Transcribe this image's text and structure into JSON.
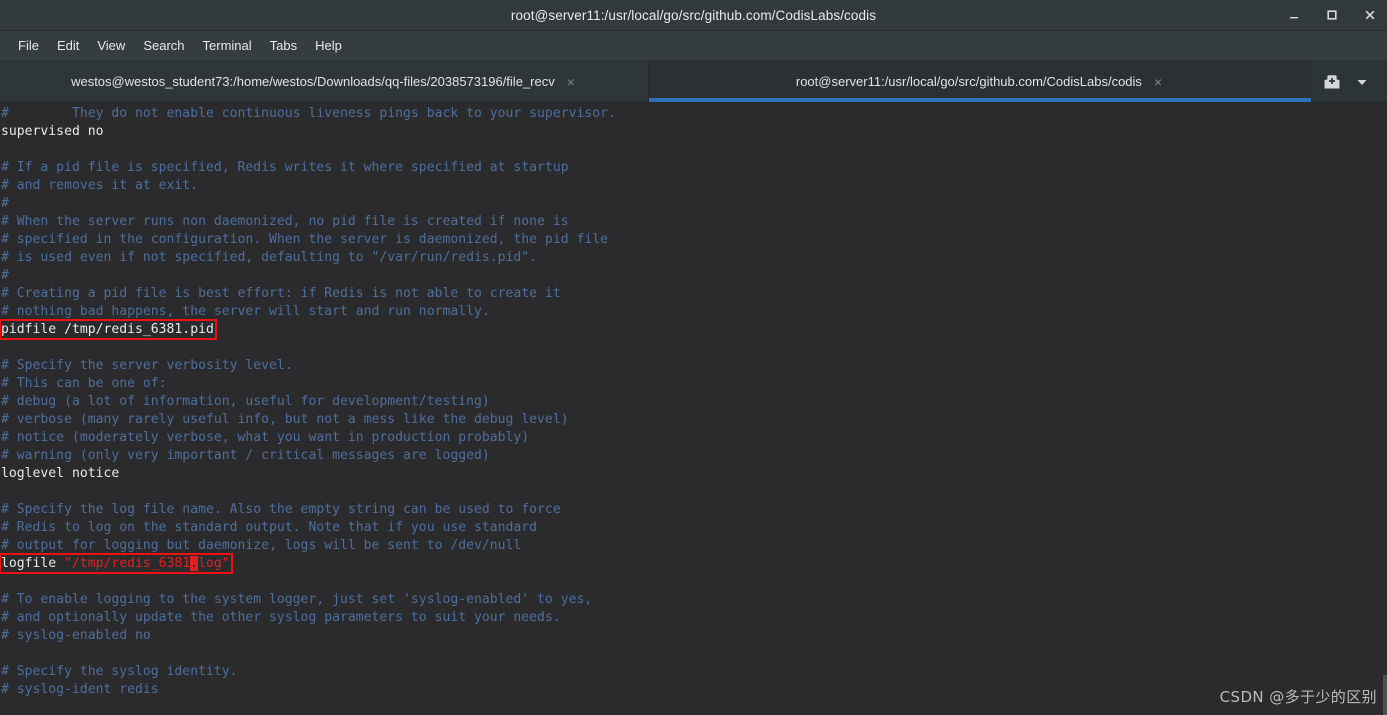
{
  "window": {
    "title": "root@server11:/usr/local/go/src/github.com/CodisLabs/codis",
    "minimize_label": "Minimize",
    "maximize_label": "Maximize",
    "close_label": "Close"
  },
  "menubar": {
    "items": [
      {
        "label": "File"
      },
      {
        "label": "Edit"
      },
      {
        "label": "View"
      },
      {
        "label": "Search"
      },
      {
        "label": "Terminal"
      },
      {
        "label": "Tabs"
      },
      {
        "label": "Help"
      }
    ]
  },
  "tabs": {
    "items": [
      {
        "label": "westos@westos_student73:/home/westos/Downloads/qq-files/2038573196/file_recv",
        "close_label": "×",
        "active": false
      },
      {
        "label": "root@server11:/usr/local/go/src/github.com/CodisLabs/codis",
        "close_label": "×",
        "active": true
      }
    ],
    "new_tab_label": "New Tab",
    "tab_menu_label": "Tab list"
  },
  "terminal": {
    "lines": [
      {
        "comment": "#        They do not enable continuous liveness pings back to your supervisor."
      },
      {
        "value": "supervised no"
      },
      {
        "blank": true
      },
      {
        "comment": "# If a pid file is specified, Redis writes it where specified at startup"
      },
      {
        "comment": "# and removes it at exit."
      },
      {
        "comment": "#"
      },
      {
        "comment": "# When the server runs non daemonized, no pid file is created if none is"
      },
      {
        "comment": "# specified in the configuration. When the server is daemonized, the pid file"
      },
      {
        "comment": "# is used even if not specified, defaulting to \"/var/run/redis.pid\"."
      },
      {
        "comment": "#"
      },
      {
        "comment": "# Creating a pid file is best effort: if Redis is not able to create it"
      },
      {
        "comment": "# nothing bad happens, the server will start and run normally."
      },
      {
        "value": "pidfile /tmp/redis_6381.pid",
        "boxed": true
      },
      {
        "blank": true
      },
      {
        "comment": "# Specify the server verbosity level."
      },
      {
        "comment": "# This can be one of:"
      },
      {
        "comment": "# debug (a lot of information, useful for development/testing)"
      },
      {
        "comment": "# verbose (many rarely useful info, but not a mess like the debug level)"
      },
      {
        "comment": "# notice (moderately verbose, what you want in production probably)"
      },
      {
        "comment": "# warning (only very important / critical messages are logged)"
      },
      {
        "value": "loglevel notice"
      },
      {
        "blank": true
      },
      {
        "comment": "# Specify the log file name. Also the empty string can be used to force"
      },
      {
        "comment": "# Redis to log on the standard output. Note that if you use standard"
      },
      {
        "comment": "# output for logging but daemonize, logs will be sent to /dev/null"
      },
      {
        "boxed": true,
        "segments": [
          {
            "text": "logfile ",
            "kind": "value"
          },
          {
            "text": "\"/tmp/redis_6381",
            "kind": "string"
          },
          {
            "text": ".",
            "kind": "cursor"
          },
          {
            "text": "log\"",
            "kind": "string"
          }
        ]
      },
      {
        "blank": true
      },
      {
        "comment": "# To enable logging to the system logger, just set 'syslog-enabled' to yes,"
      },
      {
        "comment": "# and optionally update the other syslog parameters to suit your needs."
      },
      {
        "comment": "# syslog-enabled no"
      },
      {
        "blank": true
      },
      {
        "comment": "# Specify the syslog identity."
      },
      {
        "comment": "# syslog-ident redis"
      }
    ]
  },
  "watermark": {
    "text": "CSDN @多于少的区别"
  },
  "colors": {
    "terminal_bg": "#2b2b2e",
    "titlebar_bg": "#333a3d",
    "menubar_bg": "#353d3f",
    "tabbar_bg": "#2d3436",
    "accent_blue": "#2f72ba",
    "comment_blue": "#4e6e9c",
    "annotation_red": "#ee1111",
    "string_red": "#e02020",
    "text_white": "#e8eaea"
  }
}
